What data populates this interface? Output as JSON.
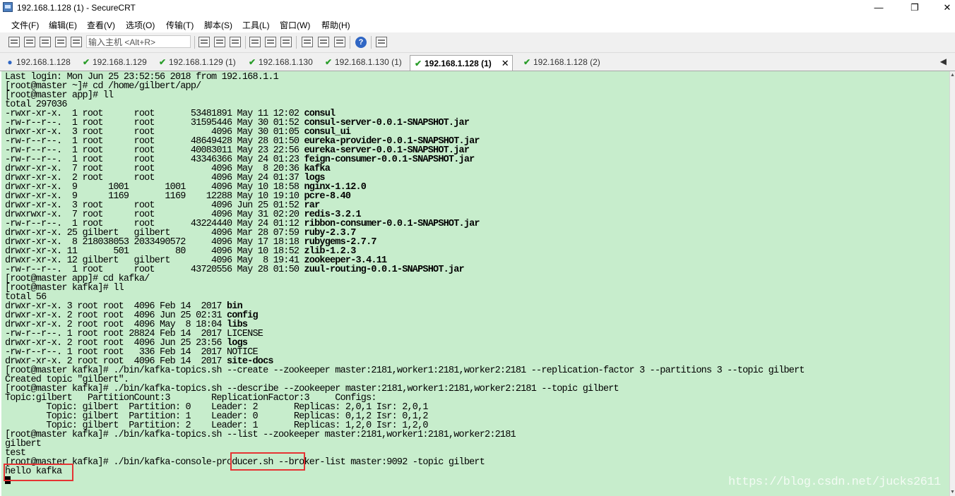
{
  "window": {
    "title": "192.168.1.128 (1) - SecureCRT",
    "min": "—",
    "max": "❐",
    "close": "✕"
  },
  "menu": [
    "文件(F)",
    "编辑(E)",
    "查看(V)",
    "选项(O)",
    "传输(T)",
    "脚本(S)",
    "工具(L)",
    "窗口(W)",
    "帮助(H)"
  ],
  "toolbar": {
    "host_placeholder": "输入主机 <Alt+R>",
    "help": "?"
  },
  "tabs": [
    {
      "label": "192.168.1.128",
      "status": "info"
    },
    {
      "label": "192.168.1.129",
      "status": "ok"
    },
    {
      "label": "192.168.1.129 (1)",
      "status": "ok"
    },
    {
      "label": "192.168.1.130",
      "status": "ok"
    },
    {
      "label": "192.168.1.130 (1)",
      "status": "ok"
    },
    {
      "label": "192.168.1.128 (1)",
      "status": "ok",
      "active": true,
      "close": "✕"
    },
    {
      "label": "192.168.1.128 (2)",
      "status": "ok"
    }
  ],
  "tab_scroll": "◀",
  "scrollbar": {
    "up": "▲",
    "down": "▼"
  },
  "terminal": {
    "lines": [
      [
        "Last login: Mon Jun 25 23:52:56 2018 from 192.168.1.1",
        ""
      ],
      [
        "[root@master ~]# cd /home/gilbert/app/",
        ""
      ],
      [
        "[root@master app]# ll",
        ""
      ],
      [
        "total 297036",
        ""
      ],
      [
        "-rwxr-xr-x.  1 root      root       53481891 May 11 12:02 ",
        "consul"
      ],
      [
        "-rw-r--r--.  1 root      root       31595446 May 30 01:52 ",
        "consul-server-0.0.1-SNAPSHOT.jar"
      ],
      [
        "drwxr-xr-x.  3 root      root           4096 May 30 01:05 ",
        "consul_ui"
      ],
      [
        "-rw-r--r--.  1 root      root       48649428 May 28 01:50 ",
        "eureka-provider-0.0.1-SNAPSHOT.jar"
      ],
      [
        "-rw-r--r--.  1 root      root       40083011 May 23 22:56 ",
        "eureka-server-0.0.1-SNAPSHOT.jar"
      ],
      [
        "-rw-r--r--.  1 root      root       43346366 May 24 01:23 ",
        "feign-consumer-0.0.1-SNAPSHOT.jar"
      ],
      [
        "drwxr-xr-x.  7 root      root           4096 May  8 20:36 ",
        "kafka"
      ],
      [
        "drwxr-xr-x.  2 root      root           4096 May 24 01:37 ",
        "logs"
      ],
      [
        "drwxr-xr-x.  9      1001       1001     4096 May 10 18:58 ",
        "nginx-1.12.0"
      ],
      [
        "drwxr-xr-x.  9      1169       1169    12288 May 10 19:10 ",
        "pcre-8.40"
      ],
      [
        "drwxr-xr-x.  3 root      root           4096 Jun 25 01:52 ",
        "rar"
      ],
      [
        "drwxrwxr-x.  7 root      root           4096 May 31 02:20 ",
        "redis-3.2.1"
      ],
      [
        "-rw-r--r--.  1 root      root       43224440 May 24 01:12 ",
        "ribbon-consumer-0.0.1-SNAPSHOT.jar"
      ],
      [
        "drwxr-xr-x. 25 gilbert   gilbert        4096 Mar 28 07:59 ",
        "ruby-2.3.7"
      ],
      [
        "drwxr-xr-x.  8 218038053 2033490572     4096 May 17 18:18 ",
        "rubygems-2.7.7"
      ],
      [
        "drwxr-xr-x. 11       501         80     4096 May 10 18:52 ",
        "zlib-1.2.3"
      ],
      [
        "drwxr-xr-x. 12 gilbert   gilbert        4096 May  8 19:41 ",
        "zookeeper-3.4.11"
      ],
      [
        "-rw-r--r--.  1 root      root       43720556 May 28 01:50 ",
        "zuul-routing-0.0.1-SNAPSHOT.jar"
      ],
      [
        "[root@master app]# cd kafka/",
        ""
      ],
      [
        "[root@master kafka]# ll",
        ""
      ],
      [
        "total 56",
        ""
      ],
      [
        "drwxr-xr-x. 3 root root  4096 Feb 14  2017 ",
        "bin"
      ],
      [
        "drwxr-xr-x. 2 root root  4096 Jun 25 02:31 ",
        "config"
      ],
      [
        "drwxr-xr-x. 2 root root  4096 May  8 18:04 ",
        "libs"
      ],
      [
        "-rw-r--r--. 1 root root 28824 Feb 14  2017 LICENSE",
        ""
      ],
      [
        "drwxr-xr-x. 2 root root  4096 Jun 25 23:56 ",
        "logs"
      ],
      [
        "-rw-r--r--. 1 root root   336 Feb 14  2017 NOTICE",
        ""
      ],
      [
        "drwxr-xr-x. 2 root root  4096 Feb 14  2017 ",
        "site-docs"
      ],
      [
        "[root@master kafka]# ./bin/kafka-topics.sh --create --zookeeper master:2181,worker1:2181,worker2:2181 --replication-factor 3 --partitions 3 --topic gilbert",
        ""
      ],
      [
        "Created topic \"gilbert\".",
        ""
      ],
      [
        "[root@master kafka]# ./bin/kafka-topics.sh --describe --zookeeper master:2181,worker1:2181,worker2:2181 --topic gilbert",
        ""
      ],
      [
        "Topic:gilbert   PartitionCount:3        ReplicationFactor:3     Configs:",
        ""
      ],
      [
        "        Topic: gilbert  Partition: 0    Leader: 2       Replicas: 2,0,1 Isr: 2,0,1",
        ""
      ],
      [
        "        Topic: gilbert  Partition: 1    Leader: 0       Replicas: 0,1,2 Isr: 0,1,2",
        ""
      ],
      [
        "        Topic: gilbert  Partition: 2    Leader: 1       Replicas: 1,2,0 Isr: 1,2,0",
        ""
      ],
      [
        "[root@master kafka]# ./bin/kafka-topics.sh --list --zookeeper master:2181,worker1:2181,worker2:2181",
        ""
      ],
      [
        "gilbert",
        ""
      ],
      [
        "test",
        ""
      ],
      [
        "[root@master kafka]# ./bin/kafka-console-producer.sh --broker-list master:9092 -topic gilbert",
        ""
      ],
      [
        "hello kafka",
        ""
      ]
    ]
  },
  "watermark": "https://blog.csdn.net/jucks2611",
  "colors": {
    "terminal_bg": "#c7edcc",
    "highlight_box": "#e53333"
  }
}
